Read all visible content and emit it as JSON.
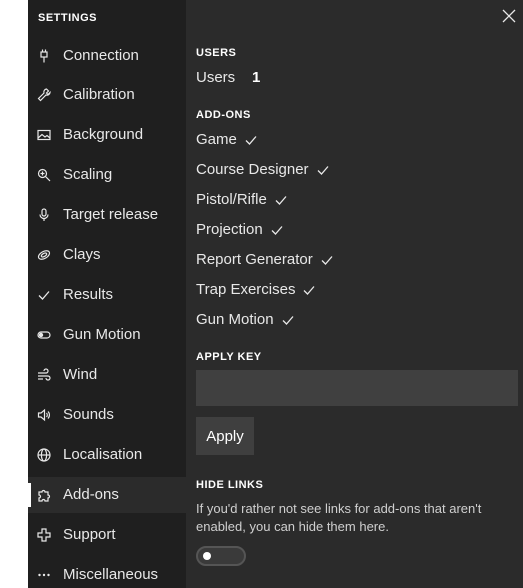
{
  "sidebar": {
    "title": "SETTINGS",
    "items": [
      {
        "label": "Connection",
        "icon": "plug-icon"
      },
      {
        "label": "Calibration",
        "icon": "wrench-icon"
      },
      {
        "label": "Background",
        "icon": "image-icon"
      },
      {
        "label": "Scaling",
        "icon": "zoom-icon"
      },
      {
        "label": "Target release",
        "icon": "microphone-icon"
      },
      {
        "label": "Clays",
        "icon": "clay-disc-icon"
      },
      {
        "label": "Results",
        "icon": "checkmark-icon"
      },
      {
        "label": "Gun Motion",
        "icon": "toggle-icon"
      },
      {
        "label": "Wind",
        "icon": "wind-icon"
      },
      {
        "label": "Sounds",
        "icon": "speaker-icon"
      },
      {
        "label": "Localisation",
        "icon": "globe-icon"
      },
      {
        "label": "Add-ons",
        "icon": "puzzle-icon",
        "active": true
      },
      {
        "label": "Support",
        "icon": "plus-icon"
      },
      {
        "label": "Miscellaneous",
        "icon": "more-icon"
      }
    ]
  },
  "main": {
    "users_heading": "USERS",
    "users_label": "Users",
    "users_count": "1",
    "addons_heading": "ADD-ONS",
    "addons": [
      {
        "label": "Game",
        "enabled": true
      },
      {
        "label": "Course Designer",
        "enabled": true
      },
      {
        "label": "Pistol/Rifle",
        "enabled": true
      },
      {
        "label": "Projection",
        "enabled": true
      },
      {
        "label": "Report Generator",
        "enabled": true
      },
      {
        "label": "Trap Exercises",
        "enabled": true
      },
      {
        "label": "Gun Motion",
        "enabled": true
      }
    ],
    "apply_key_heading": "APPLY KEY",
    "apply_key_value": "",
    "apply_button": "Apply",
    "hide_links_heading": "HIDE LINKS",
    "hide_links_description": "If you'd rather not see links for add-ons that aren't enabled, you can hide them here.",
    "hide_links_enabled": false
  },
  "colors": {
    "sidebar_bg": "#1f1f1f",
    "main_bg": "#2b2b2b",
    "text": "#e8e8e8"
  }
}
